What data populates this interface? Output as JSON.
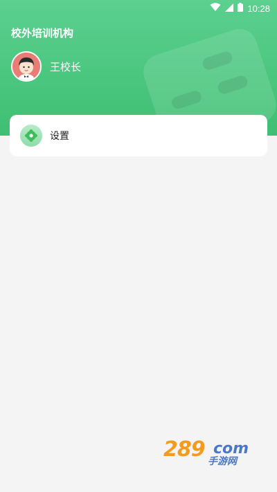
{
  "status_bar": {
    "time": "10:28"
  },
  "header": {
    "org_name": "校外培训机构",
    "user_name": "王校长"
  },
  "menu": [
    {
      "label": "设置",
      "icon": "gear-icon"
    }
  ],
  "watermark": {
    "number": "289",
    "domain": "com",
    "caption": "手游网"
  },
  "colors": {
    "header_green": "#4cc784",
    "page_background": "#f4f4f4",
    "avatar_background": "#e77d74",
    "settings_icon": "#3cbf5a"
  }
}
